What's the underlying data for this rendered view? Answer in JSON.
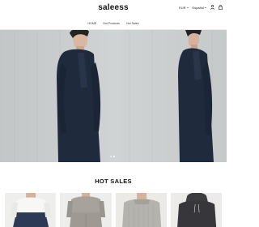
{
  "header": {
    "logo": "saleess",
    "currency": "EUR",
    "language": "Español",
    "icons": [
      "user-icon",
      "bag-icon"
    ]
  },
  "nav": {
    "items": [
      "HOME",
      "Hot Products",
      "Hot Sales"
    ]
  },
  "hero": {
    "slide_count": 2,
    "active_slide": 1
  },
  "section": {
    "title": "HOT SALES"
  },
  "products": [
    {
      "image": "white-shirt-navy-pants"
    },
    {
      "image": "grey-sweatsuit"
    },
    {
      "image": "grey-knit-sweater"
    },
    {
      "image": "dark-hoodie"
    }
  ],
  "colors": {
    "background": "#ffffff",
    "text": "#111111",
    "hero_wall": "#c9cccd",
    "jacket": "#1f2a3d"
  }
}
